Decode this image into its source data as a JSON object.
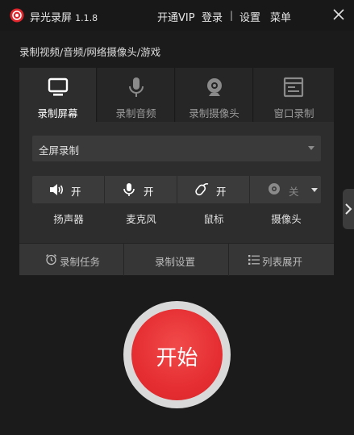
{
  "window": {
    "app_name": "异光录屏",
    "version": "1.1.8",
    "links": {
      "vip": "开通VIP",
      "login": "登录",
      "separator": "|",
      "settings": "设置",
      "menu": "菜单"
    }
  },
  "subtitle": "录制视频/音频/网络摄像头/游戏",
  "tabs": [
    {
      "label": "录制屏幕",
      "icon": "monitor-icon",
      "active": true
    },
    {
      "label": "录制音频",
      "icon": "microphone-icon",
      "active": false
    },
    {
      "label": "录制摄像头",
      "icon": "webcam-icon",
      "active": false
    },
    {
      "label": "窗口录制",
      "icon": "window-icon",
      "active": false
    }
  ],
  "mode_select": {
    "value": "全屏录制"
  },
  "devices": [
    {
      "label": "扬声器",
      "state": "开",
      "icon": "speaker-icon"
    },
    {
      "label": "麦克风",
      "state": "开",
      "icon": "microphone-icon"
    },
    {
      "label": "鼠标",
      "state": "开",
      "icon": "mouse-icon"
    },
    {
      "label": "摄像头",
      "state": "关",
      "icon": "webcam-icon"
    }
  ],
  "bottom_buttons": [
    {
      "label": "录制任务",
      "icon": "alarm-clock-icon"
    },
    {
      "label": "录制设置",
      "icon": ""
    },
    {
      "label": "列表展开",
      "icon": "list-icon"
    }
  ],
  "start_button": {
    "label": "开始"
  },
  "colors": {
    "accent": "#e52e32",
    "background": "#1b1b1b",
    "panel": "#2d2d2d"
  }
}
